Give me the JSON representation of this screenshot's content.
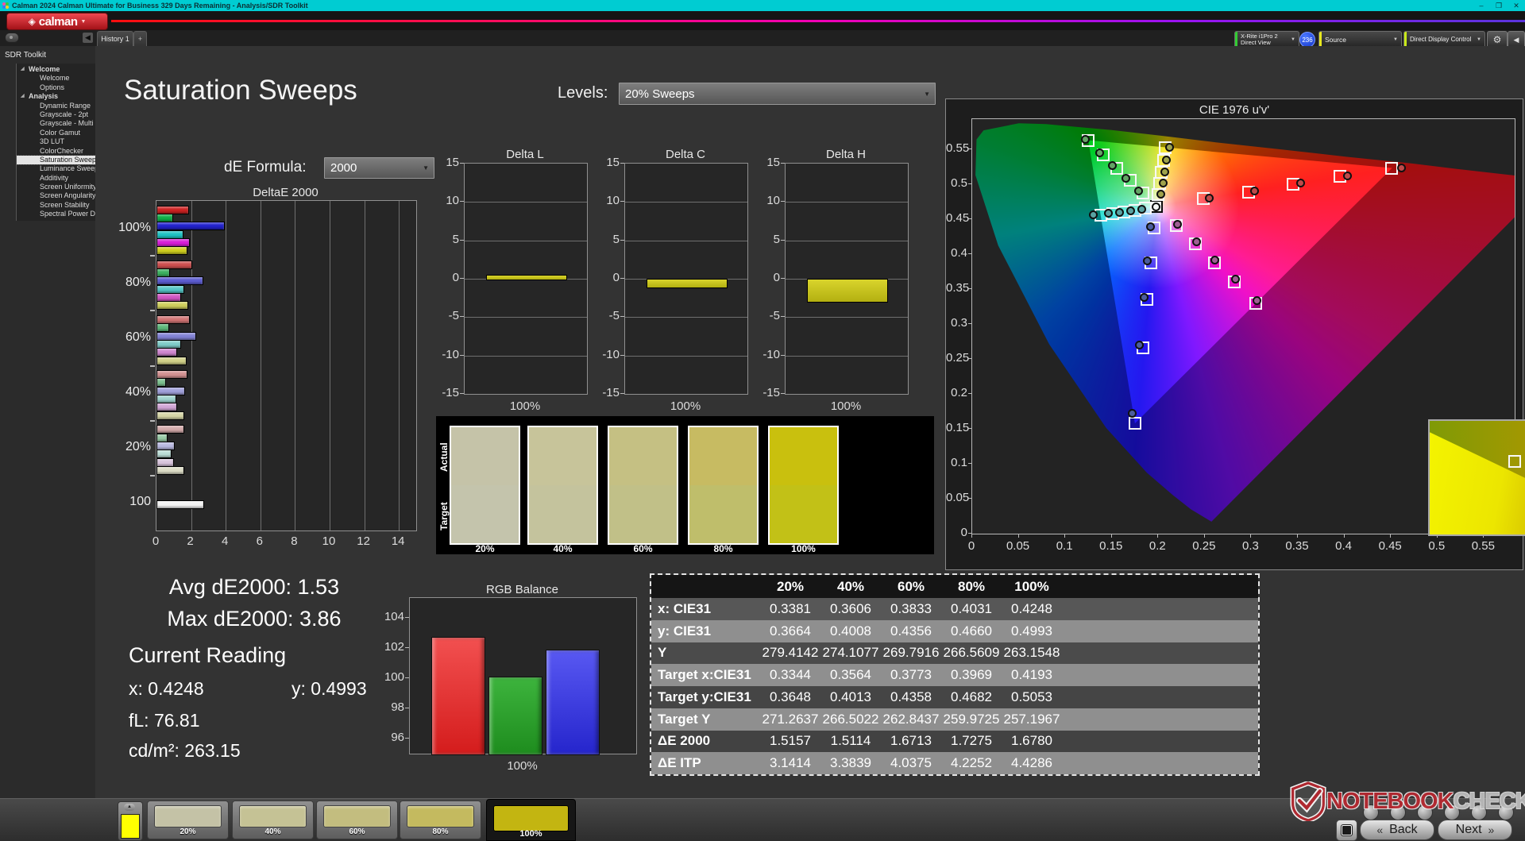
{
  "window": {
    "title": "Calman 2024 Calman Ultimate for Business 329 Days Remaining  - Analysis/SDR Toolkit",
    "minimize": "–",
    "maximize": "❐",
    "close": "✕"
  },
  "appbar": {
    "logo_text": "calman",
    "logo_mark": "◈",
    "logo_arrow": "▼"
  },
  "tabs": {
    "history": "History 1",
    "add": "+",
    "collapse_arrow": "◀"
  },
  "top_widgets": {
    "meter": {
      "line1": "X-Rite i1Pro 2",
      "line2": "Direct View",
      "accent": "#33cc33"
    },
    "badge": "236",
    "source": {
      "label": "Source",
      "accent": "#e8e820"
    },
    "display_control": {
      "label": "Direct Display Control",
      "accent": "#c8e818"
    },
    "gear_icon": "⚙",
    "collapse_icon": "◀",
    "dropdown_arrow": "▼"
  },
  "sidebar": {
    "title": "SDR Toolkit",
    "tree": [
      {
        "label": "Welcome",
        "type": "group"
      },
      {
        "label": "Welcome",
        "type": "item"
      },
      {
        "label": "Options",
        "type": "item"
      },
      {
        "label": "Analysis",
        "type": "group"
      },
      {
        "label": "Dynamic Range",
        "type": "item"
      },
      {
        "label": "Grayscale - 2pt",
        "type": "item"
      },
      {
        "label": "Grayscale - Multi",
        "type": "item"
      },
      {
        "label": "Color Gamut",
        "type": "item"
      },
      {
        "label": "3D LUT",
        "type": "item"
      },
      {
        "label": "ColorChecker",
        "type": "item"
      },
      {
        "label": "Saturation Sweeps",
        "type": "item",
        "selected": true
      },
      {
        "label": "Luminance Sweeps",
        "type": "item"
      },
      {
        "label": "Additivity",
        "type": "item"
      },
      {
        "label": "Screen Uniformity",
        "type": "item"
      },
      {
        "label": "Screen Angularity",
        "type": "item"
      },
      {
        "label": "Screen Stability",
        "type": "item"
      },
      {
        "label": "Spectral Power Dist.",
        "type": "item"
      }
    ]
  },
  "page": {
    "title": "Saturation Sweeps",
    "levels_label": "Levels:",
    "levels_value": "20% Sweeps",
    "de_formula_label": "dE Formula:",
    "de_formula_value": "2000"
  },
  "stats": {
    "avg": "Avg dE2000: 1.53",
    "max": "Max dE2000: 3.86",
    "current_reading": "Current Reading",
    "x": "x: 0.4248",
    "y": "y: 0.4993",
    "fl": "fL: 76.81",
    "cdm2": "cd/m²: 263.15"
  },
  "chart_data": {
    "deltae2000": {
      "type": "bar",
      "title": "DeltaE 2000",
      "orientation": "horizontal",
      "x_ticks": [
        0,
        2,
        4,
        6,
        8,
        10,
        12,
        14
      ],
      "x_max": 15,
      "series_order": [
        "red",
        "green",
        "blue",
        "cyan",
        "magenta",
        "yellow"
      ],
      "groups": [
        {
          "label": "100%",
          "values": [
            1.8,
            0.85,
            3.86,
            1.48,
            1.82,
            1.68
          ],
          "colors": [
            "#cc2222",
            "#0fae47",
            "#2222cc",
            "#1fc3c3",
            "#d81fd8",
            "#cfcf1f"
          ]
        },
        {
          "label": "80%",
          "values": [
            1.95,
            0.7,
            2.6,
            1.5,
            1.35,
            1.73
          ],
          "colors": [
            "#cd4f4f",
            "#3cb160",
            "#5c5cd0",
            "#54c5c5",
            "#d055c2",
            "#cfcf5c"
          ]
        },
        {
          "label": "60%",
          "values": [
            1.83,
            0.62,
            2.18,
            1.32,
            1.12,
            1.67
          ],
          "colors": [
            "#d07474",
            "#5cb87a",
            "#8383d6",
            "#7fccc8",
            "#cf86cf",
            "#d0d088"
          ]
        },
        {
          "label": "40%",
          "values": [
            1.7,
            0.48,
            1.55,
            1.05,
            1.1,
            1.51
          ],
          "colors": [
            "#d29090",
            "#7cc08f",
            "#a0a0da",
            "#9fd3cd",
            "#d2a6d6",
            "#d6d6a6"
          ]
        },
        {
          "label": "20%",
          "values": [
            1.5,
            0.55,
            0.98,
            0.8,
            0.92,
            1.52
          ],
          "colors": [
            "#d4abab",
            "#98cba6",
            "#b8b8e0",
            "#badcd6",
            "#d8c4dc",
            "#dcdcc6"
          ]
        },
        {
          "label": "100",
          "values": [
            2.65
          ],
          "colors": [
            "#f2f2f2"
          ]
        }
      ]
    },
    "delta_charts": {
      "y_ticks": [
        15,
        10,
        5,
        0,
        -5,
        -10,
        -15
      ],
      "y_range": [
        -15,
        15
      ],
      "bar_color": "#c9c61d",
      "charts": [
        {
          "title": "Delta L",
          "value": 0.5,
          "x_label": "100%"
        },
        {
          "title": "Delta C",
          "value": -1.0,
          "x_label": "100%"
        },
        {
          "title": "Delta H",
          "value": -2.9,
          "x_label": "100%"
        }
      ]
    },
    "rgb_balance": {
      "type": "bar",
      "title": "RGB Balance",
      "x_label": "100%",
      "y_ticks": [
        104,
        102,
        100,
        98,
        96
      ],
      "y_min": 95,
      "y_max": 105.3,
      "series": [
        {
          "name": "Red",
          "value": 102.7,
          "color_top": "#f25050",
          "color_bottom": "#d41c1c"
        },
        {
          "name": "Green",
          "value": 100.1,
          "color_top": "#3db43d",
          "color_bottom": "#1e8c1e"
        },
        {
          "name": "Blue",
          "value": 101.9,
          "color_top": "#5858f2",
          "color_bottom": "#2525cc"
        }
      ]
    },
    "cie": {
      "type": "scatter",
      "title": "CIE 1976 u'v'",
      "x_ticks": [
        "0",
        "0.05",
        "0.1",
        "0.15",
        "0.2",
        "0.25",
        "0.3",
        "0.35",
        "0.4",
        "0.45",
        "0.5",
        "0.55"
      ],
      "y_ticks": [
        "0",
        "0.05",
        "0.1",
        "0.15",
        "0.2",
        "0.25",
        "0.3",
        "0.35",
        "0.4",
        "0.45",
        "0.5",
        "0.55"
      ],
      "u_max": 0.583,
      "v_max": 0.593,
      "white_point": {
        "u": 0.198,
        "v": 0.468
      },
      "sweeps": [
        {
          "name": "red",
          "dot_color": "#bf4a4a",
          "targets": [
            [
              0.2486,
              0.479
            ],
            [
              0.2967,
              0.489
            ],
            [
              0.3447,
              0.5
            ],
            [
              0.3953,
              0.511
            ],
            [
              0.451,
              0.523
            ]
          ],
          "measured": [
            [
              0.2546,
              0.48
            ],
            [
              0.3037,
              0.49
            ],
            [
              0.3527,
              0.501
            ],
            [
              0.4033,
              0.512
            ],
            [
              0.461,
              0.5235
            ]
          ]
        },
        {
          "name": "green",
          "dot_color": "#63a465",
          "targets": [
            [
              0.1834,
              0.487
            ],
            [
              0.1695,
              0.505
            ],
            [
              0.1557,
              0.523
            ],
            [
              0.1411,
              0.542
            ],
            [
              0.125,
              0.5625
            ]
          ],
          "measured": [
            [
              0.179,
              0.49
            ],
            [
              0.165,
              0.508
            ],
            [
              0.151,
              0.526
            ],
            [
              0.137,
              0.545
            ],
            [
              0.1215,
              0.564
            ]
          ]
        },
        {
          "name": "blue",
          "dot_color": "#4c5d9e",
          "targets": [
            [
              0.1955,
              0.437
            ],
            [
              0.1919,
              0.387
            ],
            [
              0.1881,
              0.335
            ],
            [
              0.1831,
              0.266
            ],
            [
              0.1754,
              0.158
            ]
          ],
          "measured": [
            [
              0.192,
              0.439
            ],
            [
              0.1885,
              0.39
            ],
            [
              0.1845,
              0.338
            ],
            [
              0.1795,
              0.27
            ],
            [
              0.172,
              0.172
            ]
          ]
        },
        {
          "name": "cyan",
          "dot_color": "#59a3a3",
          "targets": [
            [
              0.186,
              0.4654
            ],
            [
              0.1746,
              0.4629
            ],
            [
              0.1632,
              0.4605
            ],
            [
              0.1512,
              0.4579
            ],
            [
              0.138,
              0.455
            ]
          ],
          "measured": [
            [
              0.182,
              0.464
            ],
            [
              0.17,
              0.462
            ],
            [
              0.158,
              0.46
            ],
            [
              0.146,
              0.458
            ],
            [
              0.13,
              0.456
            ]
          ]
        },
        {
          "name": "magenta",
          "dot_color": "#a05f93",
          "targets": [
            [
              0.2194,
              0.4404
            ],
            [
              0.2397,
              0.4142
            ],
            [
              0.26,
              0.3879
            ],
            [
              0.2814,
              0.3603
            ],
            [
              0.305,
              0.33
            ]
          ],
          "measured": [
            [
              0.221,
              0.443
            ],
            [
              0.241,
              0.417
            ],
            [
              0.261,
              0.391
            ],
            [
              0.283,
              0.364
            ],
            [
              0.306,
              0.333
            ]
          ]
        },
        {
          "name": "yellow",
          "dot_color": "#9fa34b",
          "targets": [
            [
              0.1998,
              0.4851
            ],
            [
              0.2016,
              0.5011
            ],
            [
              0.2035,
              0.5171
            ],
            [
              0.2054,
              0.534
            ],
            [
              0.2078,
              0.5525
            ]
          ],
          "measured": [
            [
              0.203,
              0.486
            ],
            [
              0.205,
              0.502
            ],
            [
              0.207,
              0.518
            ],
            [
              0.209,
              0.535
            ],
            [
              0.212,
              0.553
            ]
          ]
        }
      ],
      "inset": {
        "square": [
          0.46,
          0.36
        ],
        "dot": [
          0.58,
          0.53
        ],
        "dot_color": "#6a7a10"
      }
    },
    "table": {
      "type": "table",
      "columns": [
        "20%",
        "40%",
        "60%",
        "80%",
        "100%"
      ],
      "rows": [
        {
          "label": "x: CIE31",
          "values": [
            "0.3381",
            "0.3606",
            "0.3833",
            "0.4031",
            "0.4248"
          ]
        },
        {
          "label": "y: CIE31",
          "values": [
            "0.3664",
            "0.4008",
            "0.4356",
            "0.4660",
            "0.4993"
          ]
        },
        {
          "label": "Y",
          "values": [
            "279.4142",
            "274.1077",
            "269.7916",
            "266.5609",
            "263.1548"
          ]
        },
        {
          "label": "Target x:CIE31",
          "values": [
            "0.3344",
            "0.3564",
            "0.3773",
            "0.3969",
            "0.4193"
          ]
        },
        {
          "label": "Target y:CIE31",
          "values": [
            "0.3648",
            "0.4013",
            "0.4358",
            "0.4682",
            "0.5053"
          ]
        },
        {
          "label": "Target Y",
          "values": [
            "271.2637",
            "266.5022",
            "262.8437",
            "259.9725",
            "257.1967"
          ]
        },
        {
          "label": "ΔE 2000",
          "values": [
            "1.5157",
            "1.5114",
            "1.6713",
            "1.7275",
            "1.6780"
          ]
        },
        {
          "label": "ΔE ITP",
          "values": [
            "3.1414",
            "3.3839",
            "4.0375",
            "4.2252",
            "4.4286"
          ]
        }
      ]
    }
  },
  "swatches": {
    "row_labels": [
      "Actual",
      "Target"
    ],
    "levels": [
      "20%",
      "40%",
      "60%",
      "80%",
      "100%"
    ],
    "actual": [
      "#c5c3a8",
      "#c7c49a",
      "#c5c083",
      "#c7bb62",
      "#c9c00e"
    ],
    "target": [
      "#c4c4ac",
      "#c4c39d",
      "#c1c088",
      "#bfbe6b",
      "#c2c117"
    ]
  },
  "bottom_bar": {
    "current_patch_color": "#ffff00",
    "tiles": [
      {
        "label": "20%",
        "color": "#c4c2a6"
      },
      {
        "label": "40%",
        "color": "#c5c295"
      },
      {
        "label": "60%",
        "color": "#c3bd7f"
      },
      {
        "label": "80%",
        "color": "#c4ba5f"
      },
      {
        "label": "100%",
        "color": "#c3b511",
        "selected": true
      }
    ],
    "back_label": "Back",
    "next_label": "Next",
    "back_arrow": "«",
    "next_arrow": "»"
  },
  "watermark": {
    "text1": "NOTEBOOK",
    "text2": "CHECK"
  }
}
